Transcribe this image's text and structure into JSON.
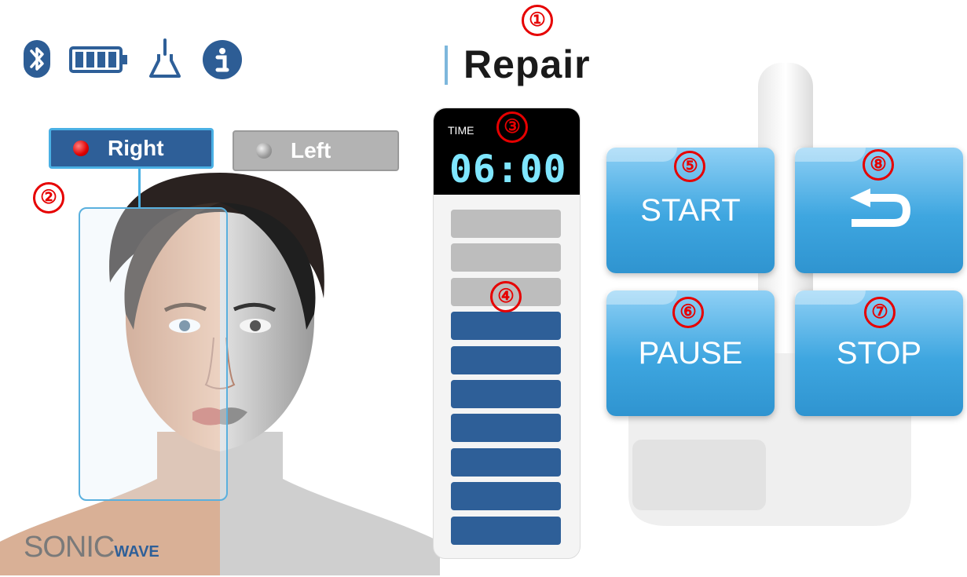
{
  "status_icons": [
    "bluetooth-icon",
    "battery-icon",
    "probe-icon",
    "info-icon"
  ],
  "title": "Repair",
  "side_selector": {
    "right_label": "Right",
    "left_label": "Left",
    "selected": "Right"
  },
  "timer": {
    "label": "TIME",
    "value": "06:00"
  },
  "level": {
    "total_segments": 10,
    "active_segments": 7
  },
  "controls": {
    "start_label": "START",
    "pause_label": "PAUSE",
    "stop_label": "STOP",
    "back_icon": "back-arrow-icon"
  },
  "brand": {
    "name_left": "SONIC",
    "name_right": "WAVE"
  },
  "callouts": [
    "①",
    "②",
    "③",
    "④",
    "⑤",
    "⑥",
    "⑦",
    "⑧"
  ],
  "colors": {
    "accent_blue": "#2e5f98",
    "button_blue": "#3ea6e0",
    "timer_digits": "#7fe6ff",
    "callout_red": "#e60000",
    "inactive_segment": "#bdbdbd"
  }
}
